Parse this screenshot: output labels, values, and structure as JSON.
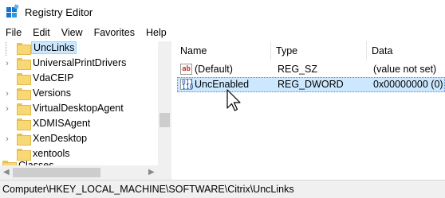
{
  "window": {
    "title": "Registry Editor"
  },
  "menu": [
    "File",
    "Edit",
    "View",
    "Favorites",
    "Help"
  ],
  "tree": {
    "items": [
      {
        "label": "UncLinks",
        "expandable": false,
        "selected": true
      },
      {
        "label": "UniversalPrintDrivers",
        "expandable": true,
        "selected": false
      },
      {
        "label": "VdaCEIP",
        "expandable": false,
        "selected": false
      },
      {
        "label": "Versions",
        "expandable": true,
        "selected": false
      },
      {
        "label": "VirtualDesktopAgent",
        "expandable": true,
        "selected": false
      },
      {
        "label": "XDMISAgent",
        "expandable": false,
        "selected": false
      },
      {
        "label": "XenDesktop",
        "expandable": true,
        "selected": false
      },
      {
        "label": "xentools",
        "expandable": false,
        "selected": false
      },
      {
        "label": "Classes",
        "expandable": false,
        "selected": false
      }
    ]
  },
  "list": {
    "columns": {
      "name": "Name",
      "type": "Type",
      "data": "Data"
    },
    "rows": [
      {
        "icon": "string-value-icon",
        "name": "(Default)",
        "type": "REG_SZ",
        "data": "(value not set)",
        "selected": false
      },
      {
        "icon": "dword-value-icon",
        "name": "UncEnabled",
        "type": "REG_DWORD",
        "data": "0x00000000 (0)",
        "selected": true
      }
    ]
  },
  "status": {
    "path": "Computer\\HKEY_LOCAL_MACHINE\\SOFTWARE\\Citrix\\UncLinks"
  }
}
